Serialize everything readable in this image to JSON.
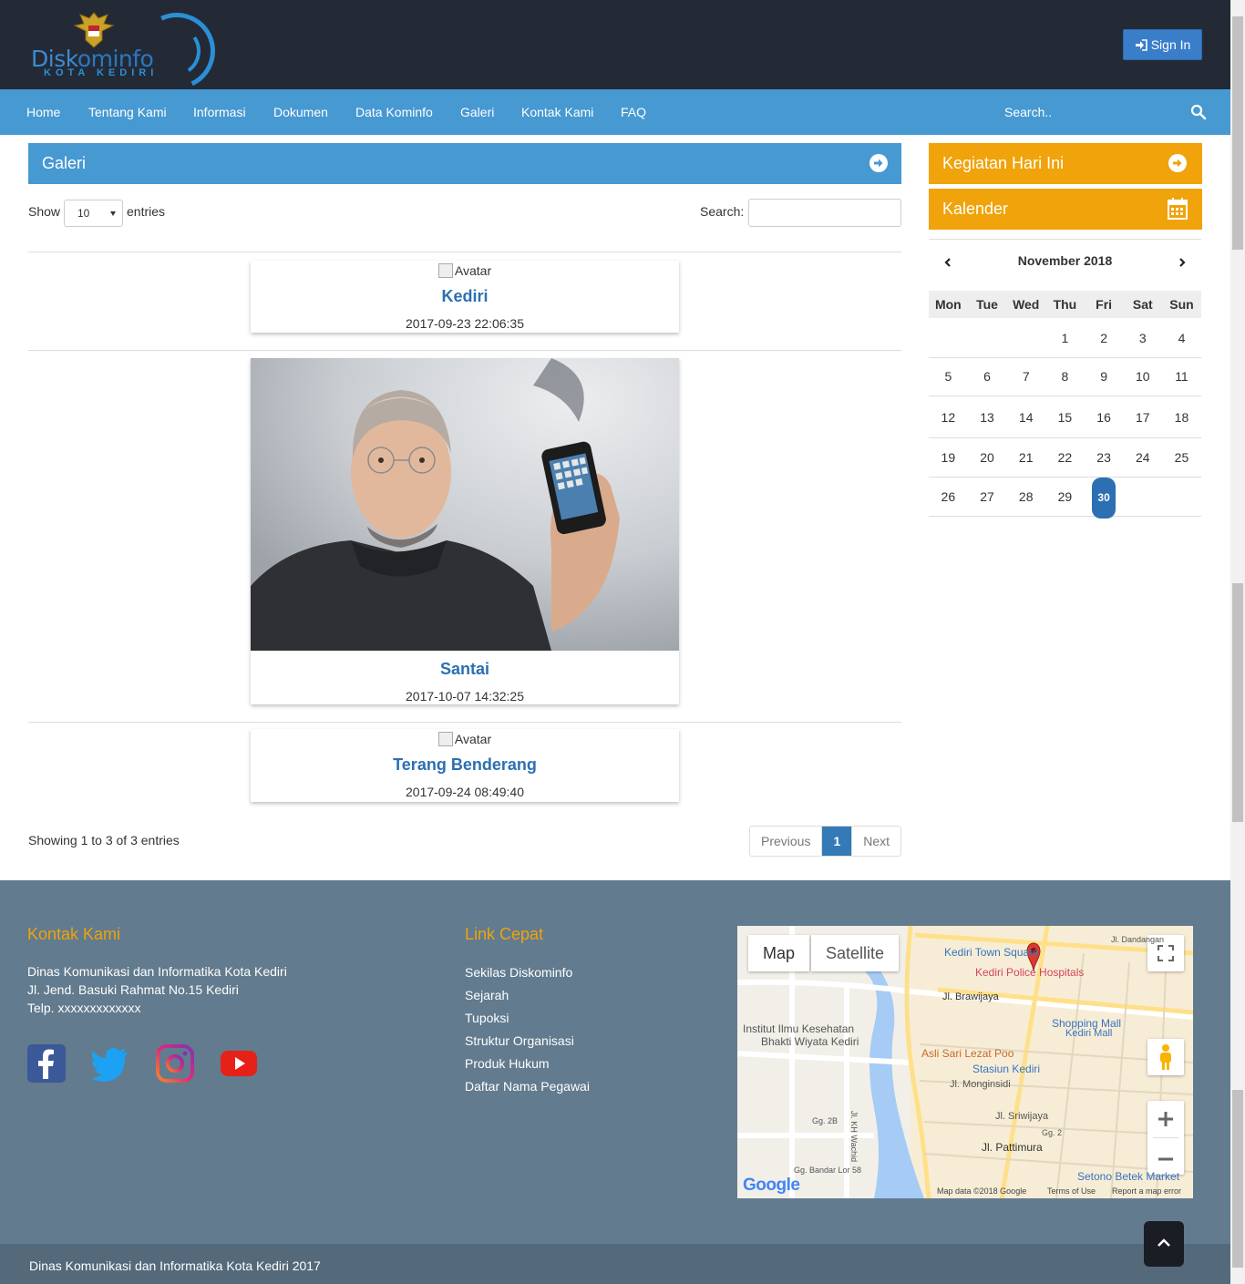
{
  "header": {
    "logo": {
      "brand_prefix": "Disk",
      "brand_mid": "om",
      "brand_suffix": "info",
      "city": "KOTA KEDIRI"
    },
    "signin_label": "Sign In"
  },
  "nav": {
    "items": [
      "Home",
      "Tentang Kami",
      "Informasi",
      "Dokumen",
      "Data Kominfo",
      "Galeri",
      "Kontak Kami",
      "FAQ"
    ],
    "search_placeholder": "Search.."
  },
  "galeri": {
    "title": "Galeri",
    "show_label": "Show",
    "page_length": "10",
    "entries_label": "entries",
    "search_label": "Search:",
    "items": [
      {
        "alt": "Avatar",
        "title": "Kediri",
        "date": "2017-09-23 22:06:35"
      },
      {
        "alt": "",
        "title": "Santai",
        "date": "2017-10-07 14:32:25"
      },
      {
        "alt": "Avatar",
        "title": "Terang Benderang",
        "date": "2017-09-24 08:49:40"
      }
    ],
    "showing": "Showing 1 to 3 of 3 entries",
    "pager": {
      "previous": "Previous",
      "current": "1",
      "next": "Next"
    }
  },
  "sidebar": {
    "kegiatan_title": "Kegiatan Hari Ini",
    "kalender_title": "Kalender",
    "calendar": {
      "month": "November 2018",
      "days": [
        "Mon",
        "Tue",
        "Wed",
        "Thu",
        "Fri",
        "Sat",
        "Sun"
      ],
      "weeks": [
        [
          "",
          "",
          "",
          "1",
          "2",
          "3",
          "4"
        ],
        [
          "5",
          "6",
          "7",
          "8",
          "9",
          "10",
          "11"
        ],
        [
          "12",
          "13",
          "14",
          "15",
          "16",
          "17",
          "18"
        ],
        [
          "19",
          "20",
          "21",
          "22",
          "23",
          "24",
          "25"
        ],
        [
          "26",
          "27",
          "28",
          "29",
          "30",
          "",
          ""
        ]
      ],
      "today": "30"
    }
  },
  "footer": {
    "kontak_title": "Kontak Kami",
    "kontak_lines": [
      "Dinas Komunikasi dan Informatika Kota Kediri",
      "Jl. Jend. Basuki Rahmat No.15 Kediri",
      "Telp. xxxxxxxxxxxxx"
    ],
    "social_icons": [
      "facebook-icon",
      "twitter-icon",
      "instagram-icon",
      "youtube-icon"
    ],
    "link_title": "Link Cepat",
    "links": [
      "Sekilas Diskominfo",
      "Sejarah",
      "Tupoksi",
      "Struktur Organisasi",
      "Produk Hukum",
      "Daftar Nama Pegawai"
    ],
    "map": {
      "type_map": "Map",
      "type_satellite": "Satellite",
      "labels": {
        "town_square": "Kediri Town Square",
        "police_hospital": "Kediri Police Hospitals",
        "brawijaya": "Jl. Brawijaya",
        "institut": "Institut Ilmu Kesehatan",
        "bhakti": "Bhakti Wiyata Kediri",
        "shopping_mall": "Shopping Mall",
        "kediri_mall": "Kediri Mall",
        "asli_sari": "Asli Sari Lezat Poo",
        "stasiun": "Stasiun Kediri",
        "monginsidi": "Jl. Monginsidi",
        "sriwijaya": "Jl. Sriwijaya",
        "pattimura": "Jl. Pattimura",
        "setono": "Setono Betek Market",
        "dandangan": "Jl. Dandangan",
        "kh_wachid": "Jl. KH Wachid",
        "gg_2b": "Gg. 2B",
        "bandar_lor": "Gg. Bandar Lor 58",
        "gg_2": "Gg. 2"
      },
      "attribution": "Map data ©2018 Google",
      "terms": "Terms of Use",
      "report": "Report a map error",
      "google": "Google"
    },
    "copyright": "Dinas Komunikasi dan Informatika Kota Kediri 2017"
  },
  "colors": {
    "header_bg": "#232a36",
    "nav_bg": "#4799d2",
    "accent_orange": "#f0a30a",
    "link_blue": "#2c6fb2",
    "footer_bg": "#627b8e",
    "bottom_bar": "#546a7b"
  }
}
